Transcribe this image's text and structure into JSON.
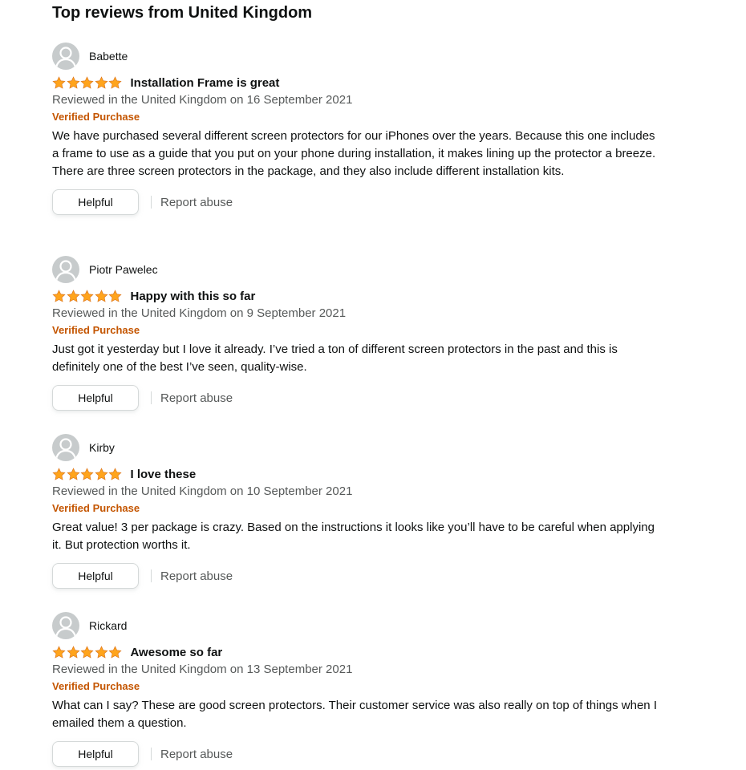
{
  "section": {
    "title": "Top reviews from United Kingdom"
  },
  "colors": {
    "star": "#ffa41c",
    "verified": "#c45500",
    "secondary_text": "#565959",
    "avatar_bg": "#c7cbcc"
  },
  "reviews": [
    {
      "avatar_icon": "default-avatar-icon",
      "name": "Babette",
      "rating": 5,
      "title": "Installation Frame is great",
      "date": "Reviewed in the United Kingdom on 16 September 2021",
      "verified": "Verified Purchase",
      "body": "We have purchased several different screen protectors for our iPhones over the years. Because this one includes a frame to use as a guide that you put on your phone during installation, it makes lining up the protector a breeze. There are three screen protectors in the package, and they also include different installation kits.",
      "helpful_label": "Helpful",
      "report_label": "Report abuse"
    },
    {
      "avatar_icon": "default-avatar-icon",
      "name": "Piotr Pawelec",
      "rating": 5,
      "title": "Happy with this so far",
      "date": "Reviewed in the United Kingdom on 9 September 2021",
      "verified": "Verified Purchase",
      "body": "Just got it yesterday but I love it already. I’ve tried a ton of different screen protectors in the past and this is definitely one of the best I’ve seen, quality-wise.",
      "helpful_label": "Helpful",
      "report_label": "Report abuse"
    },
    {
      "avatar_icon": "default-avatar-icon",
      "name": "Kirby",
      "rating": 5,
      "title": "I love these",
      "date": "Reviewed in the United Kingdom on 10 September 2021",
      "verified": "Verified Purchase",
      "body": "Great value! 3 per package is crazy. Based on the instructions it looks like you’ll have to be careful when applying it. But protection worths it.",
      "helpful_label": "Helpful",
      "report_label": "Report abuse"
    },
    {
      "avatar_icon": "default-avatar-icon",
      "name": "Rickard",
      "rating": 5,
      "title": "Awesome so far",
      "date": "Reviewed in the United Kingdom on 13 September 2021",
      "verified": "Verified Purchase",
      "body": "What can I say? These are good screen protectors. Their customer service was also really on top of things when I emailed them a question.",
      "helpful_label": "Helpful",
      "report_label": "Report abuse"
    }
  ]
}
